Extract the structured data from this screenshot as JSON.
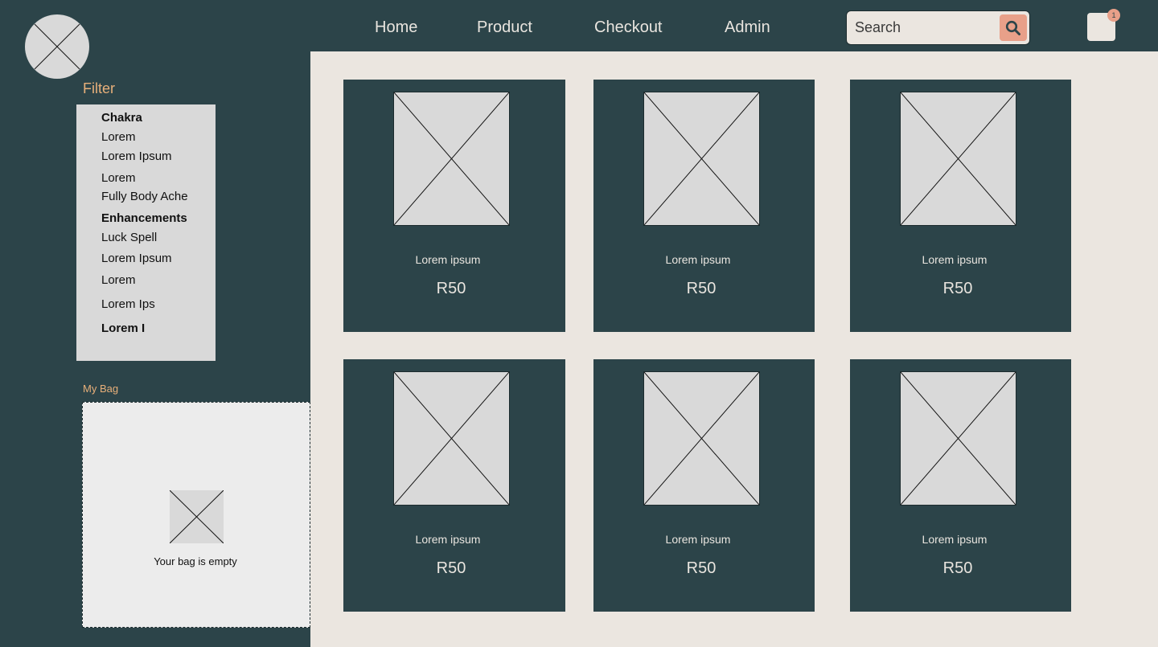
{
  "header": {
    "logo_icon": "placeholder-image-icon",
    "nav": [
      {
        "label": "Home"
      },
      {
        "label": "Product"
      },
      {
        "label": "Checkout"
      },
      {
        "label": "Admin"
      }
    ],
    "search": {
      "placeholder": "Search",
      "value": "",
      "button_icon": "search-icon"
    },
    "cart": {
      "icon": "cart-icon",
      "badge": "1"
    }
  },
  "filter": {
    "title": "Filter",
    "items": [
      {
        "label": "Chakra",
        "bold": true
      },
      {
        "label": "Lorem"
      },
      {
        "label": "Lorem Ipsum"
      },
      {
        "label": "Lorem"
      },
      {
        "label": "Fully Body Ache"
      },
      {
        "label": "Enhancements",
        "bold": true
      },
      {
        "label": "Luck Spell"
      },
      {
        "label": "Lorem Ipsum"
      },
      {
        "label": "Lorem"
      },
      {
        "label": "Lorem Ips"
      },
      {
        "label": "Lorem I",
        "bold": true
      }
    ]
  },
  "bag": {
    "title": "My Bag",
    "empty_text": "Your bag is empty"
  },
  "products": [
    {
      "name": "Lorem ipsum",
      "price": "R50"
    },
    {
      "name": "Lorem ipsum",
      "price": "R50"
    },
    {
      "name": "Lorem ipsum",
      "price": "R50"
    },
    {
      "name": "Lorem ipsum",
      "price": "R50"
    },
    {
      "name": "Lorem ipsum",
      "price": "R50"
    },
    {
      "name": "Lorem ipsum",
      "price": "R50"
    }
  ],
  "colors": {
    "primary_dark": "#2c4449",
    "background_light": "#ebe6e0",
    "accent_orange": "#e8b07a",
    "accent_salmon": "#e8a089",
    "placeholder_gray": "#d9d9d9"
  }
}
